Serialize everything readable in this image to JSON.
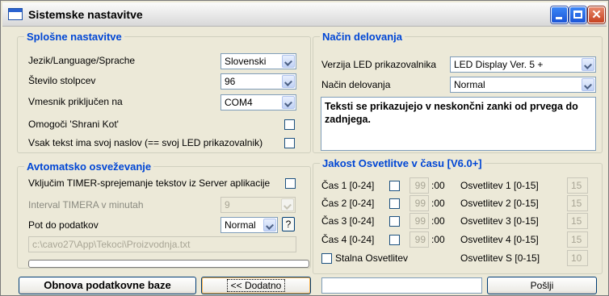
{
  "window": {
    "title": "Sistemske nastavitve"
  },
  "general": {
    "legend": "Splošne nastavitve",
    "language_label": "Jezik/Language/Sprache",
    "language_value": "Slovenski",
    "columns_label": "Število stolpcev",
    "columns_value": "96",
    "interface_label": "Vmesnik priključen na",
    "interface_value": "COM4",
    "save_corner_label": "Omogoči 'Shrani Kot'",
    "own_title_label": "Vsak tekst ima svoj naslov (== svoj LED prikazovalnik)"
  },
  "mode": {
    "legend": "Način delovanja",
    "version_label": "Verzija LED prikazovalnika",
    "version_value": "LED Display Ver. 5 +",
    "mode_label": "Način delovanja",
    "mode_value": "Normal",
    "description": "Teksti se prikazujejo v neskončni zanki od prvega do zadnjega."
  },
  "auto": {
    "legend": "Avtomatsko osveževanje",
    "timer_label": "Vključim TIMER-sprejemanje tekstov iz Server aplikacije",
    "interval_label": "Interval TIMERA v minutah",
    "interval_value": "9",
    "path_label": "Pot do podatkov",
    "path_mode_value": "Normal",
    "help_label": "?",
    "path_value": "c:\\cavo27\\App\\Tekoci\\Proizvodnja.txt"
  },
  "brightness": {
    "legend": "Jakost Osvetlitve v času [V6.0+]",
    "rows": [
      {
        "time_label": "Čas 1 [0-24]",
        "hour": "99",
        "minutes": ":00",
        "level_label": "Osvetlitev 1 [0-15]",
        "level": "15"
      },
      {
        "time_label": "Čas 2 [0-24]",
        "hour": "99",
        "minutes": ":00",
        "level_label": "Osvetlitev 2 [0-15]",
        "level": "15"
      },
      {
        "time_label": "Čas 3 [0-24]",
        "hour": "99",
        "minutes": ":00",
        "level_label": "Osvetlitev 3 [0-15]",
        "level": "15"
      },
      {
        "time_label": "Čas 4 [0-24]",
        "hour": "99",
        "minutes": ":00",
        "level_label": "Osvetlitev 4 [0-15]",
        "level": "15"
      }
    ],
    "constant_label": "Stalna Osvetlitev",
    "constant_level_label": "Osvetlitev S [0-15]",
    "constant_level": "10"
  },
  "footer": {
    "refresh_button": "Obnova podatkovne baze",
    "more_button": "<< Dodatno",
    "send_button": "Pošlji"
  }
}
